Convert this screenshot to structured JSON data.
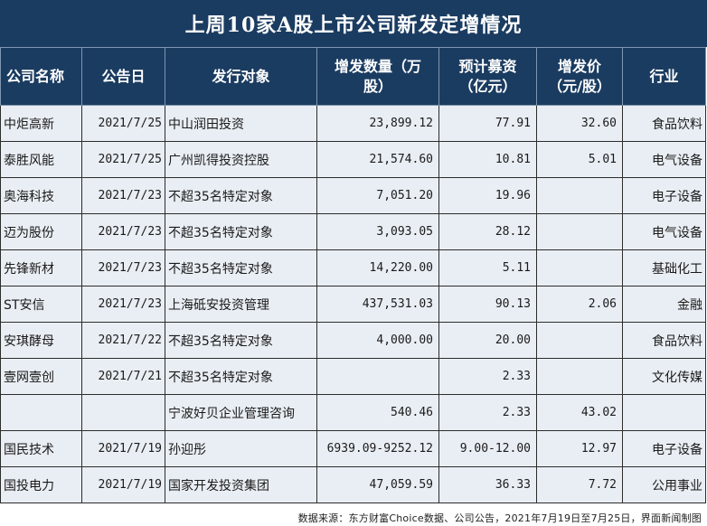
{
  "title": "上周10家A股上市公司新发定增情况",
  "headers": {
    "company": "公司名称",
    "date": "公告日",
    "target": "发行对象",
    "shares_line1": "增发数量（万",
    "shares_line2": "股）",
    "funds_line1": "预计募资",
    "funds_line2": "（亿元）",
    "price_line1": "增发价",
    "price_line2": "（元/股）",
    "industry": "行业"
  },
  "rows": [
    {
      "company": "中炬高新",
      "date": "2021/7/25",
      "target": "中山润田投资",
      "shares": "23,899.12",
      "funds": "77.91",
      "price": "32.60",
      "industry": "食品饮料"
    },
    {
      "company": "泰胜风能",
      "date": "2021/7/25",
      "target": "广州凯得投资控股",
      "shares": "21,574.60",
      "funds": "10.81",
      "price": "5.01",
      "industry": "电气设备"
    },
    {
      "company": "奥海科技",
      "date": "2021/7/23",
      "target": "不超35名特定对象",
      "shares": "7,051.20",
      "funds": "19.96",
      "price": "",
      "industry": "电子设备"
    },
    {
      "company": "迈为股份",
      "date": "2021/7/23",
      "target": "不超35名特定对象",
      "shares": "3,093.05",
      "funds": "28.12",
      "price": "",
      "industry": "电气设备"
    },
    {
      "company": "先锋新材",
      "date": "2021/7/23",
      "target": "不超35名特定对象",
      "shares": "14,220.00",
      "funds": "5.11",
      "price": "",
      "industry": "基础化工"
    },
    {
      "company": "ST安信",
      "date": "2021/7/23",
      "target": "上海砥安投资管理",
      "shares": "437,531.03",
      "funds": "90.13",
      "price": "2.06",
      "industry": "金融"
    },
    {
      "company": "安琪酵母",
      "date": "2021/7/22",
      "target": "不超35名特定对象",
      "shares": "4,000.00",
      "funds": "20.00",
      "price": "",
      "industry": "食品饮料"
    },
    {
      "company": "壹网壹创",
      "date": "2021/7/21",
      "target": "不超35名特定对象",
      "shares": "",
      "funds": "2.33",
      "price": "",
      "industry": "文化传媒"
    },
    {
      "company": "",
      "date": "",
      "target": "宁波好贝企业管理咨询",
      "shares": "540.46",
      "funds": "2.33",
      "price": "43.02",
      "industry": ""
    },
    {
      "company": "国民技术",
      "date": "2021/7/19",
      "target": "孙迎彤",
      "shares": "6939.09-9252.12",
      "funds": "9.00-12.00",
      "price": "12.97",
      "industry": "电子设备"
    },
    {
      "company": "国投电力",
      "date": "2021/7/19",
      "target": "国家开发投资集团",
      "shares": "47,059.59",
      "funds": "36.33",
      "price": "7.72",
      "industry": "公用事业"
    }
  ],
  "source": "数据来源：东方财富Choice数据、公司公告，2021年7月19日至7月25日，界面新闻制图"
}
